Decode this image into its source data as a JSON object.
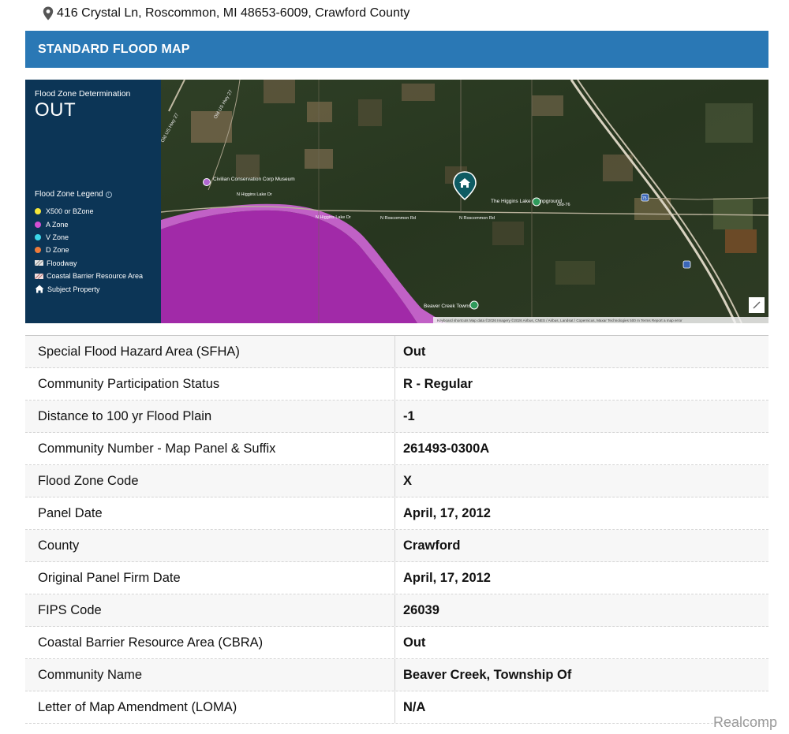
{
  "header": {
    "address": "416 Crystal Ln, Roscommon, MI 48653-6009, Crawford County"
  },
  "banner": {
    "title": "STANDARD FLOOD MAP"
  },
  "map": {
    "determination_label": "Flood Zone Determination",
    "determination_value": "OUT",
    "legend_title": "Flood Zone Legend",
    "legend_items": [
      {
        "label": "X500 or BZone",
        "icon": "yellow-dot",
        "color": "#f5e63a"
      },
      {
        "label": "A Zone",
        "icon": "magenta-dot",
        "color": "#d34fd3"
      },
      {
        "label": "V Zone",
        "icon": "cyan-dot",
        "color": "#3cd6e8"
      },
      {
        "label": "D Zone",
        "icon": "orange-dot",
        "color": "#ee7b3a"
      },
      {
        "label": "Floodway",
        "icon": "floodway-swatch"
      },
      {
        "label": "Coastal Barrier Resource Area",
        "icon": "cbra-swatch"
      },
      {
        "label": "Subject Property",
        "icon": "house-icon"
      }
    ],
    "labels": {
      "museum": "Civilian Conservation Corp Museum",
      "road_higgins_lake": "N Higgins Lake Dr",
      "road_roscommon": "N Roscommon Rd",
      "campground": "The Higgins Lake Campground",
      "old76": "Old-76",
      "township": "Beaver Creek Township",
      "hwy27": "Old US Hwy 27",
      "hwy27b": "Old US Hwy 27",
      "route_i75": "75",
      "attribution": "Keyboard shortcuts   Map data ©2026 Imagery ©2026 Airbus, CNES / Airbus, Landsat / Copernicus, Maxar Technologies   500 m        Terms   Report a map error"
    }
  },
  "table": {
    "rows": [
      {
        "label": "Special Flood Hazard Area (SFHA)",
        "value": "Out"
      },
      {
        "label": "Community Participation Status",
        "value": "R - Regular"
      },
      {
        "label": "Distance to 100 yr Flood Plain",
        "value": "-1"
      },
      {
        "label": "Community Number - Map Panel & Suffix",
        "value": "261493-0300A"
      },
      {
        "label": "Flood Zone Code",
        "value": "X"
      },
      {
        "label": "Panel Date",
        "value": "April, 17, 2012"
      },
      {
        "label": "County",
        "value": "Crawford"
      },
      {
        "label": "Original Panel Firm Date",
        "value": "April, 17, 2012"
      },
      {
        "label": "FIPS Code",
        "value": "26039"
      },
      {
        "label": "Coastal Barrier Resource Area (CBRA)",
        "value": "Out"
      },
      {
        "label": "Community Name",
        "value": "Beaver Creek, Township Of"
      },
      {
        "label": "Letter of Map Amendment (LOMA)",
        "value": "N/A"
      }
    ]
  },
  "watermark": "Realcomp",
  "colors": {
    "banner": "#2a78b5",
    "legend_panel": "#0c3556",
    "flood_zone_a": "#a12aa8",
    "property_marker": "#0e5b63"
  }
}
